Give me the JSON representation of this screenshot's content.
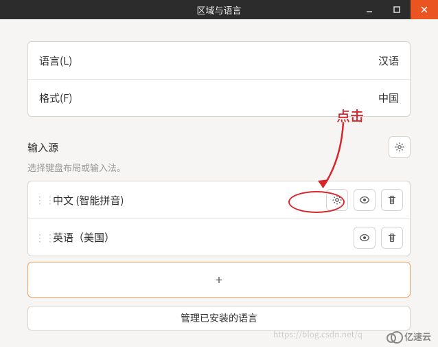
{
  "window": {
    "title": "区域与语言"
  },
  "settings": {
    "language": {
      "label": "语言(L)",
      "value": "汉语"
    },
    "format": {
      "label": "格式(F)",
      "value": "中国"
    }
  },
  "input_sources": {
    "title": "输入源",
    "subtitle": "选择键盘布局或输入法。",
    "items": [
      {
        "name": "中文 (智能拼音)",
        "has_settings": true
      },
      {
        "name": "英语（美国）",
        "has_settings": false
      }
    ],
    "add_label": "+",
    "manage_label": "管理已安装的语言"
  },
  "annotations": {
    "click_label": "点击"
  },
  "watermark": {
    "url": "https://blog.csdn.net/q",
    "brand": "亿速云"
  }
}
